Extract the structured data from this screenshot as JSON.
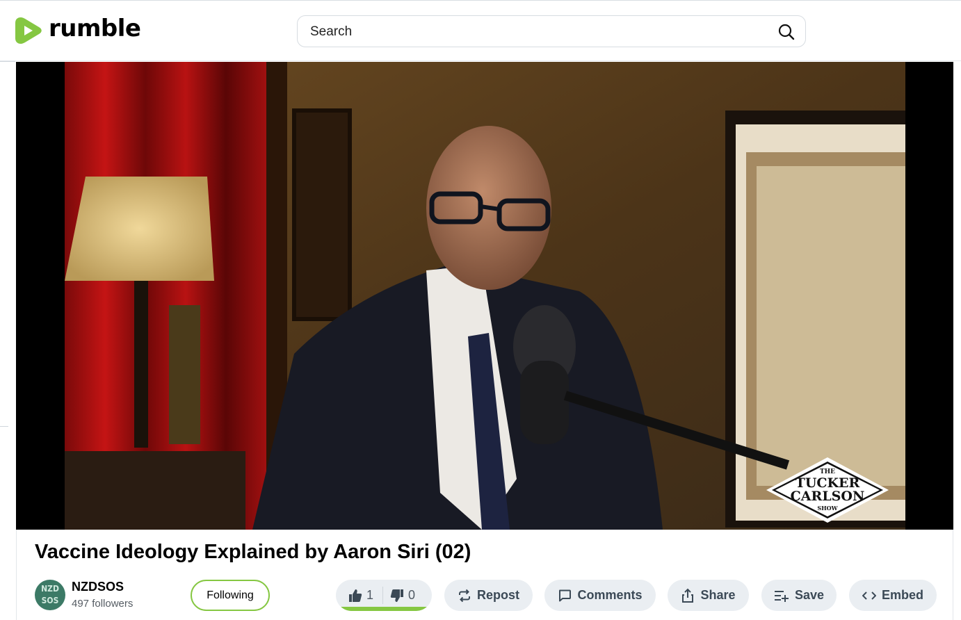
{
  "header": {
    "brand": "rumble",
    "search_placeholder": "Search"
  },
  "video": {
    "overlay_logo_lines": [
      "THE",
      "TUCKER",
      "CARLSON",
      "SHOW"
    ]
  },
  "title": "Vaccine Ideology Explained by Aaron Siri (02)",
  "channel": {
    "avatar_lines": [
      "NZD",
      "SOS"
    ],
    "name": "NZDSOS",
    "followers": "497 followers",
    "follow_label": "Following"
  },
  "votes": {
    "likes": "1",
    "dislikes": "0",
    "like_fraction": 1.0
  },
  "actions": {
    "repost": "Repost",
    "comments": "Comments",
    "share": "Share",
    "save": "Save",
    "embed": "Embed"
  },
  "colors": {
    "brand_green": "#85c742",
    "button_bg": "#eaeef2",
    "button_text": "#3b4956"
  }
}
